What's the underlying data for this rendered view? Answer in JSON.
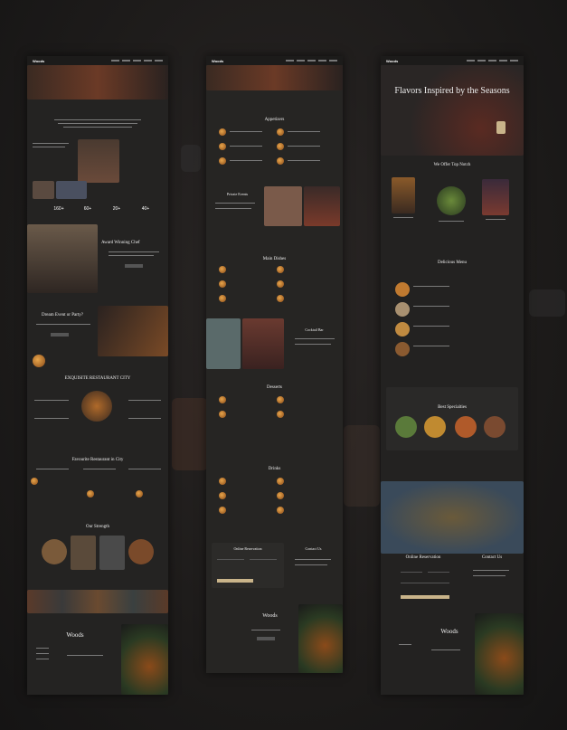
{
  "brand": "Woods",
  "column1": {
    "stats": [
      "160+",
      "60+",
      "20+",
      "40+"
    ],
    "sections": {
      "award": "Award Winning Chef",
      "private": "Dream Event or Party?",
      "finest": "EXQUISITE RESTAURANT CITY",
      "favourite": "Favourite Restaurant in City",
      "strength": "Our Strength"
    },
    "footer_title": "Woods"
  },
  "column2": {
    "sections": {
      "appetizers": "Appetizers",
      "private": "Private Events",
      "main": "Main Dishes",
      "bar": "Cocktail Bar",
      "desserts": "Desserts",
      "drinks": "Drinks",
      "reservation": "Online Reservation",
      "contact": "Contact Us"
    },
    "footer_title": "Woods"
  },
  "column3": {
    "hero_title": "Flavors Inspired by the Seasons",
    "sections": {
      "offer": "We Offer Top Notch",
      "delicious": "Delicious Menu",
      "specialties": "Best Specialties",
      "reservation": "Online Reservation",
      "contact": "Contact Us"
    },
    "footer_title": "Woods"
  },
  "colors": {
    "background": "#1b1b1b",
    "panel": "#242322",
    "accent": "#c9b48a",
    "food": "#e7a54b"
  }
}
